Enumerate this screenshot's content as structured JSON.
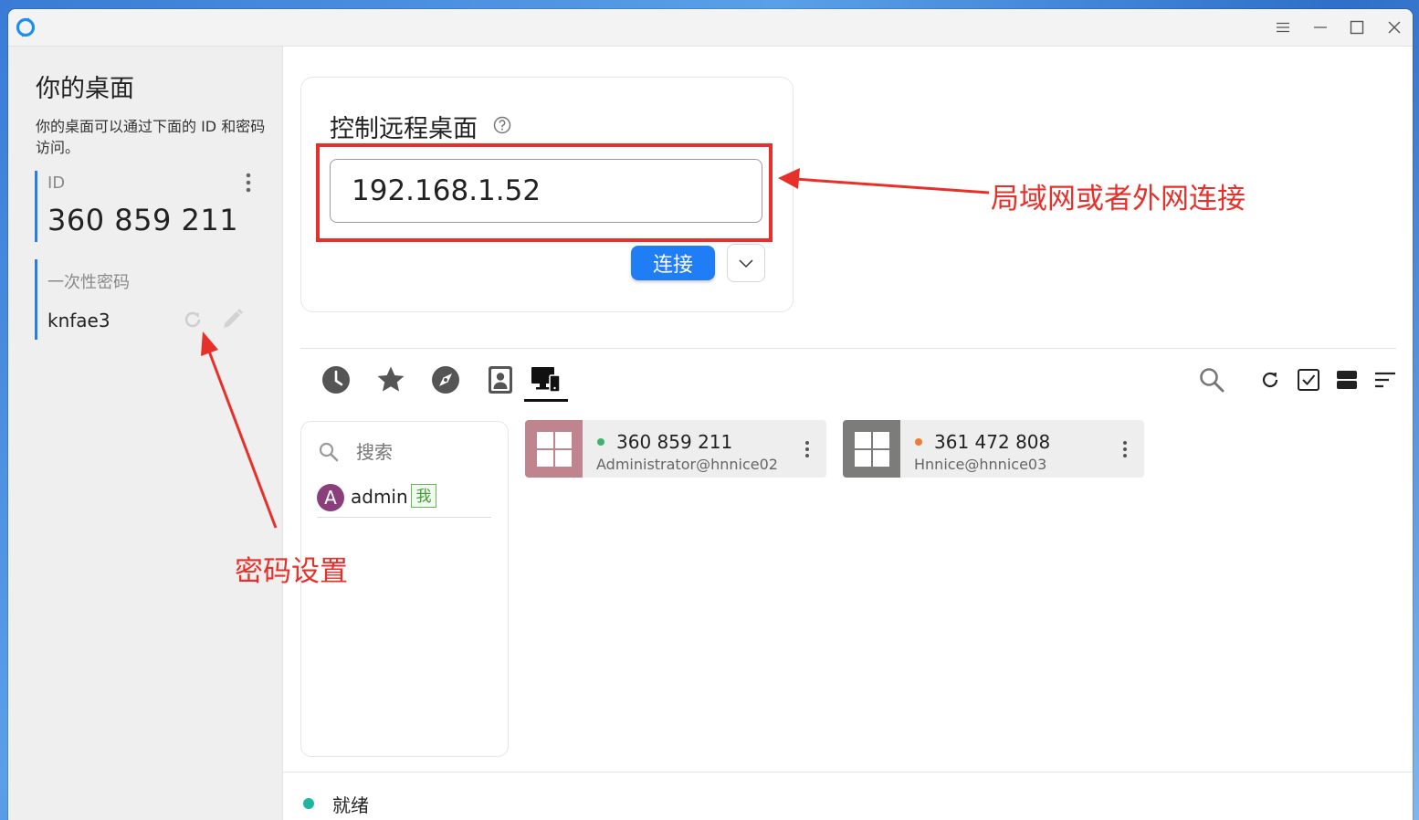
{
  "colors": {
    "accent": "#1f7ef5",
    "annotation": "#e8302a",
    "online": "#3cb371",
    "ready": "#1fb5a0"
  },
  "titlebar": {
    "icons": [
      "menu-icon",
      "minimize-icon",
      "maximize-icon",
      "close-icon"
    ]
  },
  "sidebar": {
    "title": "你的桌面",
    "description": "你的桌面可以通过下面的 ID 和密码访问。",
    "id_label": "ID",
    "id_value": "360 859 211",
    "password_label": "一次性密码",
    "password_value": "knfae3"
  },
  "connect": {
    "title": "控制远程桌面",
    "address_value": "192.168.1.52",
    "connect_label": "连接"
  },
  "tabs": [
    "recent-sessions",
    "favorites",
    "discovered",
    "address-book",
    "accessible-devices"
  ],
  "active_tab": "accessible-devices",
  "groups": {
    "search_placeholder": "搜索",
    "users": [
      {
        "avatar": "A",
        "name": "admin",
        "badge": "我",
        "avatar_color": "#8a3e7b"
      }
    ]
  },
  "peers": [
    {
      "id": "360 859 211",
      "user": "Administrator@hnnice02",
      "thumb_color": "#c0848f",
      "status_color": "#3cb371"
    },
    {
      "id": "361 472 808",
      "user": "Hnnice@hnnice03",
      "thumb_color": "#7c7c7a",
      "status_color": "#f07a3a"
    }
  ],
  "status": {
    "text": "就绪"
  },
  "annotations": {
    "network": "局域网或者外网连接",
    "password": "密码设置"
  }
}
